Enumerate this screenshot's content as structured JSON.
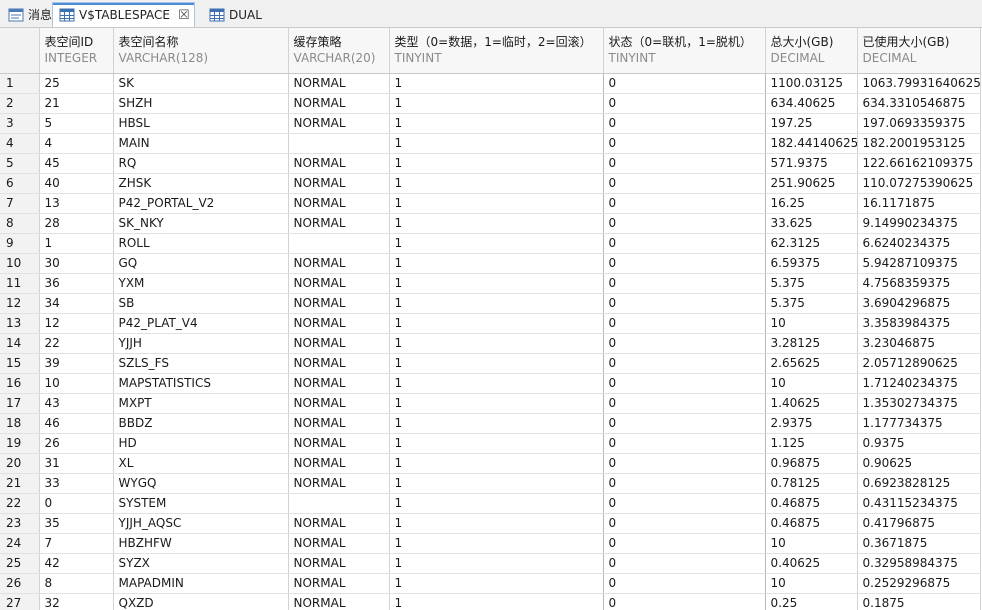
{
  "tabs": [
    {
      "label": "消息",
      "icon": "message-icon",
      "active": false
    },
    {
      "label": "V$TABLESPACE",
      "icon": "table-icon",
      "active": true
    },
    {
      "label": "DUAL",
      "icon": "table-icon",
      "active": false
    }
  ],
  "columns": [
    {
      "name": "表空间ID",
      "type": "INTEGER"
    },
    {
      "name": "表空间名称",
      "type": "VARCHAR(128)"
    },
    {
      "name": "缓存策略",
      "type": "VARCHAR(20)"
    },
    {
      "name": "类型（0=数据，1=临时，2=回滚）",
      "type": "TINYINT"
    },
    {
      "name": "状态（0=联机，1=脱机）",
      "type": "TINYINT"
    },
    {
      "name": "总大小(GB)",
      "type": "DECIMAL"
    },
    {
      "name": "已使用大小(GB)",
      "type": "DECIMAL"
    }
  ],
  "rows": [
    [
      "1",
      "25",
      "SK",
      "NORMAL",
      "1",
      "0",
      "1100.03125",
      "1063.79931640625"
    ],
    [
      "2",
      "21",
      "SHZH",
      "NORMAL",
      "1",
      "0",
      "634.40625",
      "634.3310546875"
    ],
    [
      "3",
      "5",
      "HBSL",
      "NORMAL",
      "1",
      "0",
      "197.25",
      "197.0693359375"
    ],
    [
      "4",
      "4",
      "MAIN",
      "",
      "1",
      "0",
      "182.44140625",
      "182.2001953125"
    ],
    [
      "5",
      "45",
      "RQ",
      "NORMAL",
      "1",
      "0",
      "571.9375",
      "122.66162109375"
    ],
    [
      "6",
      "40",
      "ZHSK",
      "NORMAL",
      "1",
      "0",
      "251.90625",
      "110.07275390625"
    ],
    [
      "7",
      "13",
      "P42_PORTAL_V2",
      "NORMAL",
      "1",
      "0",
      "16.25",
      "16.1171875"
    ],
    [
      "8",
      "28",
      "SK_NKY",
      "NORMAL",
      "1",
      "0",
      "33.625",
      "9.14990234375"
    ],
    [
      "9",
      "1",
      "ROLL",
      "",
      "1",
      "0",
      "62.3125",
      "6.6240234375"
    ],
    [
      "10",
      "30",
      "GQ",
      "NORMAL",
      "1",
      "0",
      "6.59375",
      "5.94287109375"
    ],
    [
      "11",
      "36",
      "YXM",
      "NORMAL",
      "1",
      "0",
      "5.375",
      "4.7568359375"
    ],
    [
      "12",
      "34",
      "SB",
      "NORMAL",
      "1",
      "0",
      "5.375",
      "3.6904296875"
    ],
    [
      "13",
      "12",
      "P42_PLAT_V4",
      "NORMAL",
      "1",
      "0",
      "10",
      "3.3583984375"
    ],
    [
      "14",
      "22",
      "YJJH",
      "NORMAL",
      "1",
      "0",
      "3.28125",
      "3.23046875"
    ],
    [
      "15",
      "39",
      "SZLS_FS",
      "NORMAL",
      "1",
      "0",
      "2.65625",
      "2.05712890625"
    ],
    [
      "16",
      "10",
      "MAPSTATISTICS",
      "NORMAL",
      "1",
      "0",
      "10",
      "1.71240234375"
    ],
    [
      "17",
      "43",
      "MXPT",
      "NORMAL",
      "1",
      "0",
      "1.40625",
      "1.35302734375"
    ],
    [
      "18",
      "46",
      "BBDZ",
      "NORMAL",
      "1",
      "0",
      "2.9375",
      "1.177734375"
    ],
    [
      "19",
      "26",
      "HD",
      "NORMAL",
      "1",
      "0",
      "1.125",
      "0.9375"
    ],
    [
      "20",
      "31",
      "XL",
      "NORMAL",
      "1",
      "0",
      "0.96875",
      "0.90625"
    ],
    [
      "21",
      "33",
      "WYGQ",
      "NORMAL",
      "1",
      "0",
      "0.78125",
      "0.6923828125"
    ],
    [
      "22",
      "0",
      "SYSTEM",
      "",
      "1",
      "0",
      "0.46875",
      "0.43115234375"
    ],
    [
      "23",
      "35",
      "YJJH_AQSC",
      "NORMAL",
      "1",
      "0",
      "0.46875",
      "0.41796875"
    ],
    [
      "24",
      "7",
      "HBZHFW",
      "NORMAL",
      "1",
      "0",
      "10",
      "0.3671875"
    ],
    [
      "25",
      "42",
      "SYZX",
      "NORMAL",
      "1",
      "0",
      "0.40625",
      "0.32958984375"
    ],
    [
      "26",
      "8",
      "MAPADMIN",
      "NORMAL",
      "1",
      "0",
      "10",
      "0.2529296875"
    ],
    [
      "27",
      "32",
      "QXZD",
      "NORMAL",
      "1",
      "0",
      "0.25",
      "0.1875"
    ]
  ]
}
